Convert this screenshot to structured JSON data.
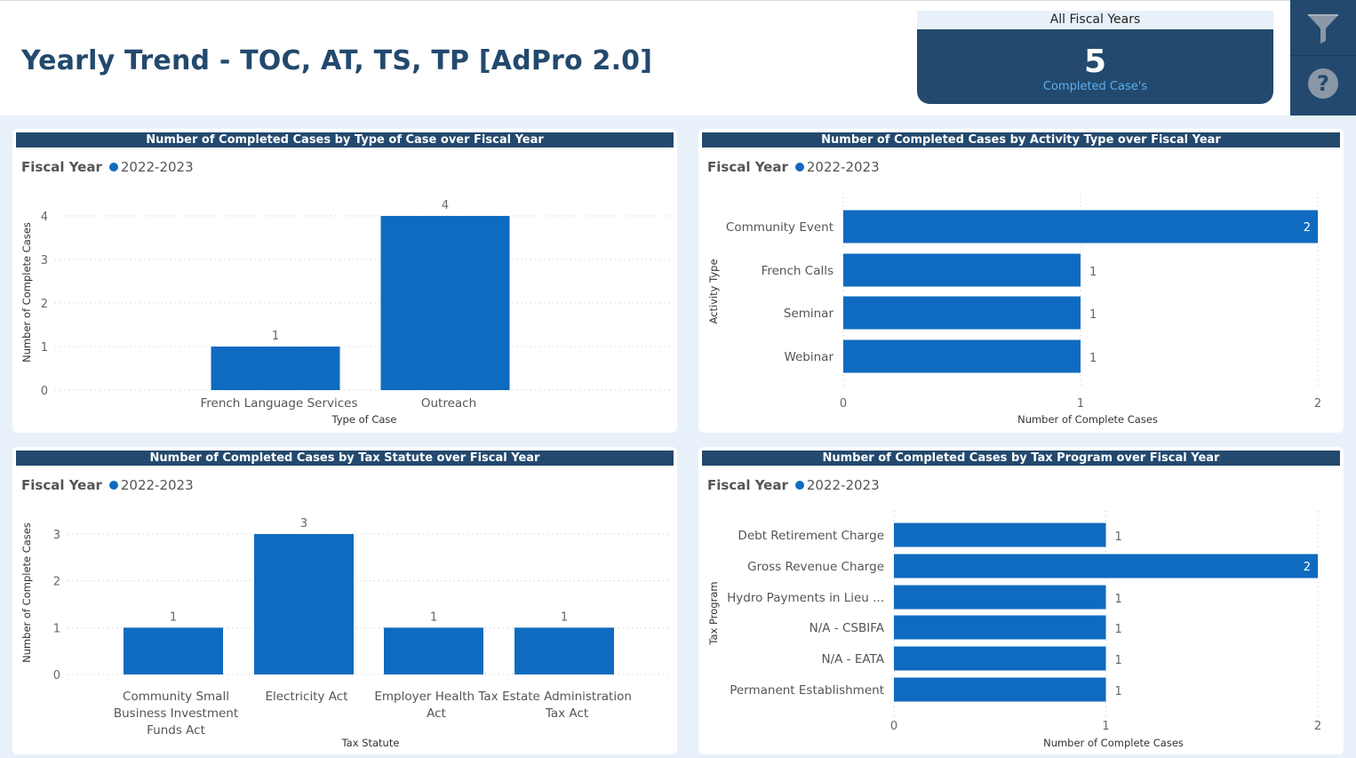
{
  "header": {
    "title": "Yearly Trend - TOC, AT, TS, TP [AdPro 2.0]"
  },
  "kpi": {
    "header": "All Fiscal Years",
    "value": "5",
    "label": "Completed Case's"
  },
  "sidebar": {
    "buttons": [
      {
        "icon": "filter-icon"
      },
      {
        "icon": "help-icon"
      }
    ]
  },
  "colors": {
    "bar": "#0f6bbf",
    "title_bar": "#23496e",
    "background": "#e8f1fa"
  },
  "panels": [
    {
      "title": "Number of Completed Cases by Type of Case over Fiscal Year",
      "legend_title": "Fiscal Year",
      "legend_item": "2022-2023"
    },
    {
      "title": "Number of Completed Cases by Activity Type over Fiscal Year",
      "legend_title": "Fiscal Year",
      "legend_item": "2022-2023"
    },
    {
      "title": "Number of Completed Cases by Tax Statute over Fiscal Year",
      "legend_title": "Fiscal Year",
      "legend_item": "2022-2023"
    },
    {
      "title": "Number of Completed Cases by Tax Program over Fiscal Year",
      "legend_title": "Fiscal Year",
      "legend_item": "2022-2023"
    }
  ],
  "chart_data": [
    {
      "type": "bar",
      "orientation": "vertical",
      "categories": [
        "French Language Services",
        "Outreach"
      ],
      "values": [
        1,
        4
      ],
      "series": [
        {
          "name": "2022-2023",
          "values": [
            1,
            4
          ]
        }
      ],
      "xlabel": "Type of Case",
      "ylabel": "Number of Complete Cases",
      "yticks": [
        "0",
        "1",
        "2",
        "3",
        "4"
      ],
      "ylim": [
        0,
        4
      ],
      "grid": true,
      "legend": "top-left"
    },
    {
      "type": "bar",
      "orientation": "horizontal",
      "categories": [
        "Community Event",
        "French Calls",
        "Seminar",
        "Webinar"
      ],
      "values": [
        2,
        1,
        1,
        1
      ],
      "series": [
        {
          "name": "2022-2023",
          "values": [
            2,
            1,
            1,
            1
          ]
        }
      ],
      "xlabel": "Number of Complete Cases",
      "ylabel": "Activity Type",
      "xticks": [
        "0",
        "1",
        "2"
      ],
      "xlim": [
        0,
        2
      ],
      "grid": true,
      "legend": "top-left"
    },
    {
      "type": "bar",
      "orientation": "vertical",
      "categories": [
        [
          "Community Small",
          "Business Investment",
          "Funds Act"
        ],
        [
          "Electricity Act"
        ],
        [
          "Employer Health Tax",
          "Act"
        ],
        [
          "Estate Administration",
          "Tax Act"
        ]
      ],
      "values": [
        1,
        3,
        1,
        1
      ],
      "series": [
        {
          "name": "2022-2023",
          "values": [
            1,
            3,
            1,
            1
          ]
        }
      ],
      "xlabel": "Tax Statute",
      "ylabel": "Number of Complete Cases",
      "yticks": [
        "0",
        "1",
        "2",
        "3"
      ],
      "ylim": [
        0,
        3
      ],
      "grid": true,
      "legend": "top-left"
    },
    {
      "type": "bar",
      "orientation": "horizontal",
      "categories": [
        "Debt Retirement Charge",
        "Gross Revenue Charge",
        "Hydro Payments in Lieu ...",
        "N/A - CSBIFA",
        "N/A - EATA",
        "Permanent Establishment"
      ],
      "values": [
        1,
        2,
        1,
        1,
        1,
        1
      ],
      "series": [
        {
          "name": "2022-2023",
          "values": [
            1,
            2,
            1,
            1,
            1,
            1
          ]
        }
      ],
      "xlabel": "Number of Complete Cases",
      "ylabel": "Tax Program",
      "xticks": [
        "0",
        "1",
        "2"
      ],
      "xlim": [
        0,
        2
      ],
      "grid": true,
      "legend": "top-left"
    }
  ]
}
